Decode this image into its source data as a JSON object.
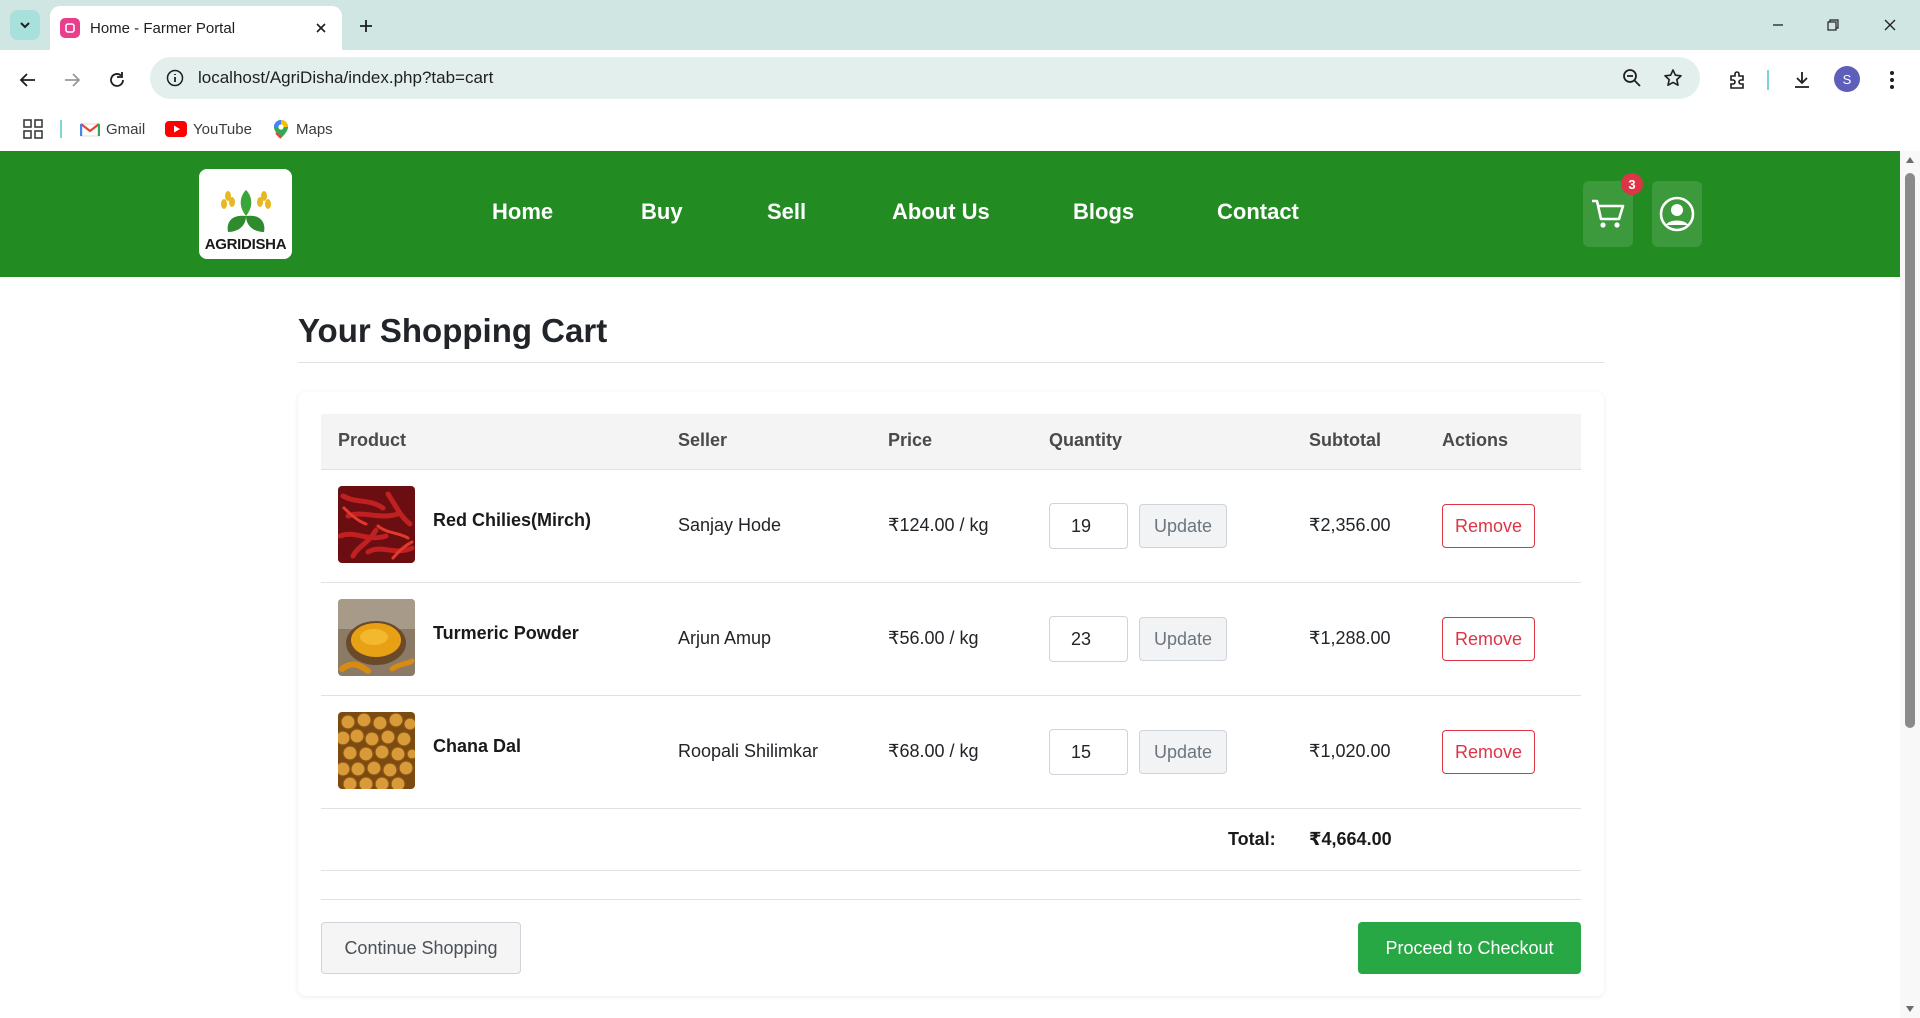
{
  "browser": {
    "tab_title": "Home - Farmer Portal",
    "url": "localhost/AgriDisha/index.php?tab=cart",
    "profile_initial": "S",
    "bookmarks": [
      {
        "label": "Gmail",
        "icon": "gmail-icon"
      },
      {
        "label": "YouTube",
        "icon": "youtube-icon"
      },
      {
        "label": "Maps",
        "icon": "maps-icon"
      }
    ]
  },
  "header": {
    "logo_text": "AGRIDISHA",
    "nav": [
      "Home",
      "Buy",
      "Sell",
      "About Us",
      "Blogs",
      "Contact"
    ],
    "cart_count": "3",
    "colors": {
      "header_bg": "#228b22",
      "badge": "#dc3545"
    }
  },
  "cart": {
    "title": "Your Shopping Cart",
    "columns": [
      "Product",
      "Seller",
      "Price",
      "Quantity",
      "Subtotal",
      "Actions"
    ],
    "items": [
      {
        "name": "Red Chilies(Mirch)",
        "seller": "Sanjay Hode",
        "price": "₹124.00 / kg",
        "quantity": "19",
        "update": "Update",
        "subtotal": "₹2,356.00",
        "remove": "Remove"
      },
      {
        "name": "Turmeric Powder",
        "seller": "Arjun Amup",
        "price": "₹56.00 / kg",
        "quantity": "23",
        "update": "Update",
        "subtotal": "₹1,288.00",
        "remove": "Remove"
      },
      {
        "name": "Chana Dal",
        "seller": "Roopali Shilimkar",
        "price": "₹68.00 / kg",
        "quantity": "15",
        "update": "Update",
        "subtotal": "₹1,020.00",
        "remove": "Remove"
      }
    ],
    "total_label": "Total:",
    "total_value": "₹4,664.00",
    "continue_label": "Continue Shopping",
    "checkout_label": "Proceed to Checkout",
    "colors": {
      "checkout": "#28a745",
      "remove": "#dc3545"
    }
  }
}
